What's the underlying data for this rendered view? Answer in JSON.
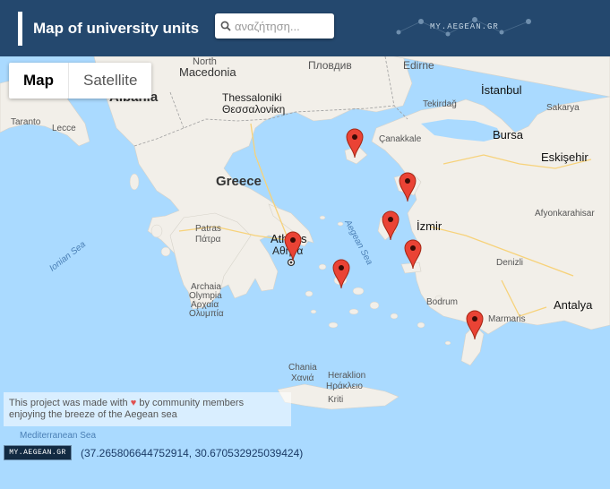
{
  "header": {
    "title": "Map of university units",
    "search_placeholder": "αναζήτηση...",
    "logo_text": "MY.AEGEAN.GR"
  },
  "map_type_control": {
    "buttons": [
      {
        "label": "Map",
        "active": true
      },
      {
        "label": "Satellite",
        "active": false
      }
    ]
  },
  "map_labels": {
    "north_macedonia_1": "North",
    "north_macedonia_2": "Macedonia",
    "plovdiv": "Пловдив",
    "edirne": "Edirne",
    "istanbul": "İstanbul",
    "albania": "Albania",
    "taranto": "Taranto",
    "lecce": "Lecce",
    "thessaloniki": "Thessaloniki",
    "thessaloniki_gr": "Θεσσαλονίκη",
    "tekirdag": "Tekirdağ",
    "sakarya": "Sakarya",
    "canakkale": "Çanakkale",
    "bursa": "Bursa",
    "eskisehir": "Eskişehir",
    "greece": "Greece",
    "izmir": "İzmir",
    "afyonkarahisar": "Afyonkarahisar",
    "patras": "Patras",
    "patras_gr": "Πάτρα",
    "athens": "Athens",
    "athens_gr": "Αθήνα",
    "ionian_sea": "Ionian Sea",
    "aegean_sea": "Aegean Sea",
    "denizli": "Denizli",
    "archaia_olympia": "Archaia",
    "archaia_olympia_2": "Olympia",
    "archaia_olympia_gr": "Αρχαία",
    "archaia_olympia_gr_2": "Ολυμπία",
    "antalya": "Antalya",
    "bodrum": "Bodrum",
    "marmaris": "Marmaris",
    "chania": "Chania",
    "chania_gr": "Χανιά",
    "heraklion": "Heraklion",
    "heraklion_gr": "Ηράκλειο",
    "kriti": "Kriti",
    "mediterranean_sea": "Mediterranean Sea"
  },
  "markers": [
    {
      "name": "marker-lemnos"
    },
    {
      "name": "marker-lesvos"
    },
    {
      "name": "marker-chios"
    },
    {
      "name": "marker-samos"
    },
    {
      "name": "marker-athens"
    },
    {
      "name": "marker-syros"
    },
    {
      "name": "marker-rhodes"
    }
  ],
  "footer": {
    "note_prefix": "This project was made with",
    "note_suffix": "by community members",
    "note_line2": "enjoying the breeze of the Aegean sea",
    "coordinates": "(37.265806644752914, 30.670532925039424)",
    "logo_text": "MY.AEGEAN.GR"
  },
  "colors": {
    "header_bg": "#24486e",
    "sea": "#aadaff",
    "land": "#f2efe9",
    "marker": "#ea4335"
  }
}
